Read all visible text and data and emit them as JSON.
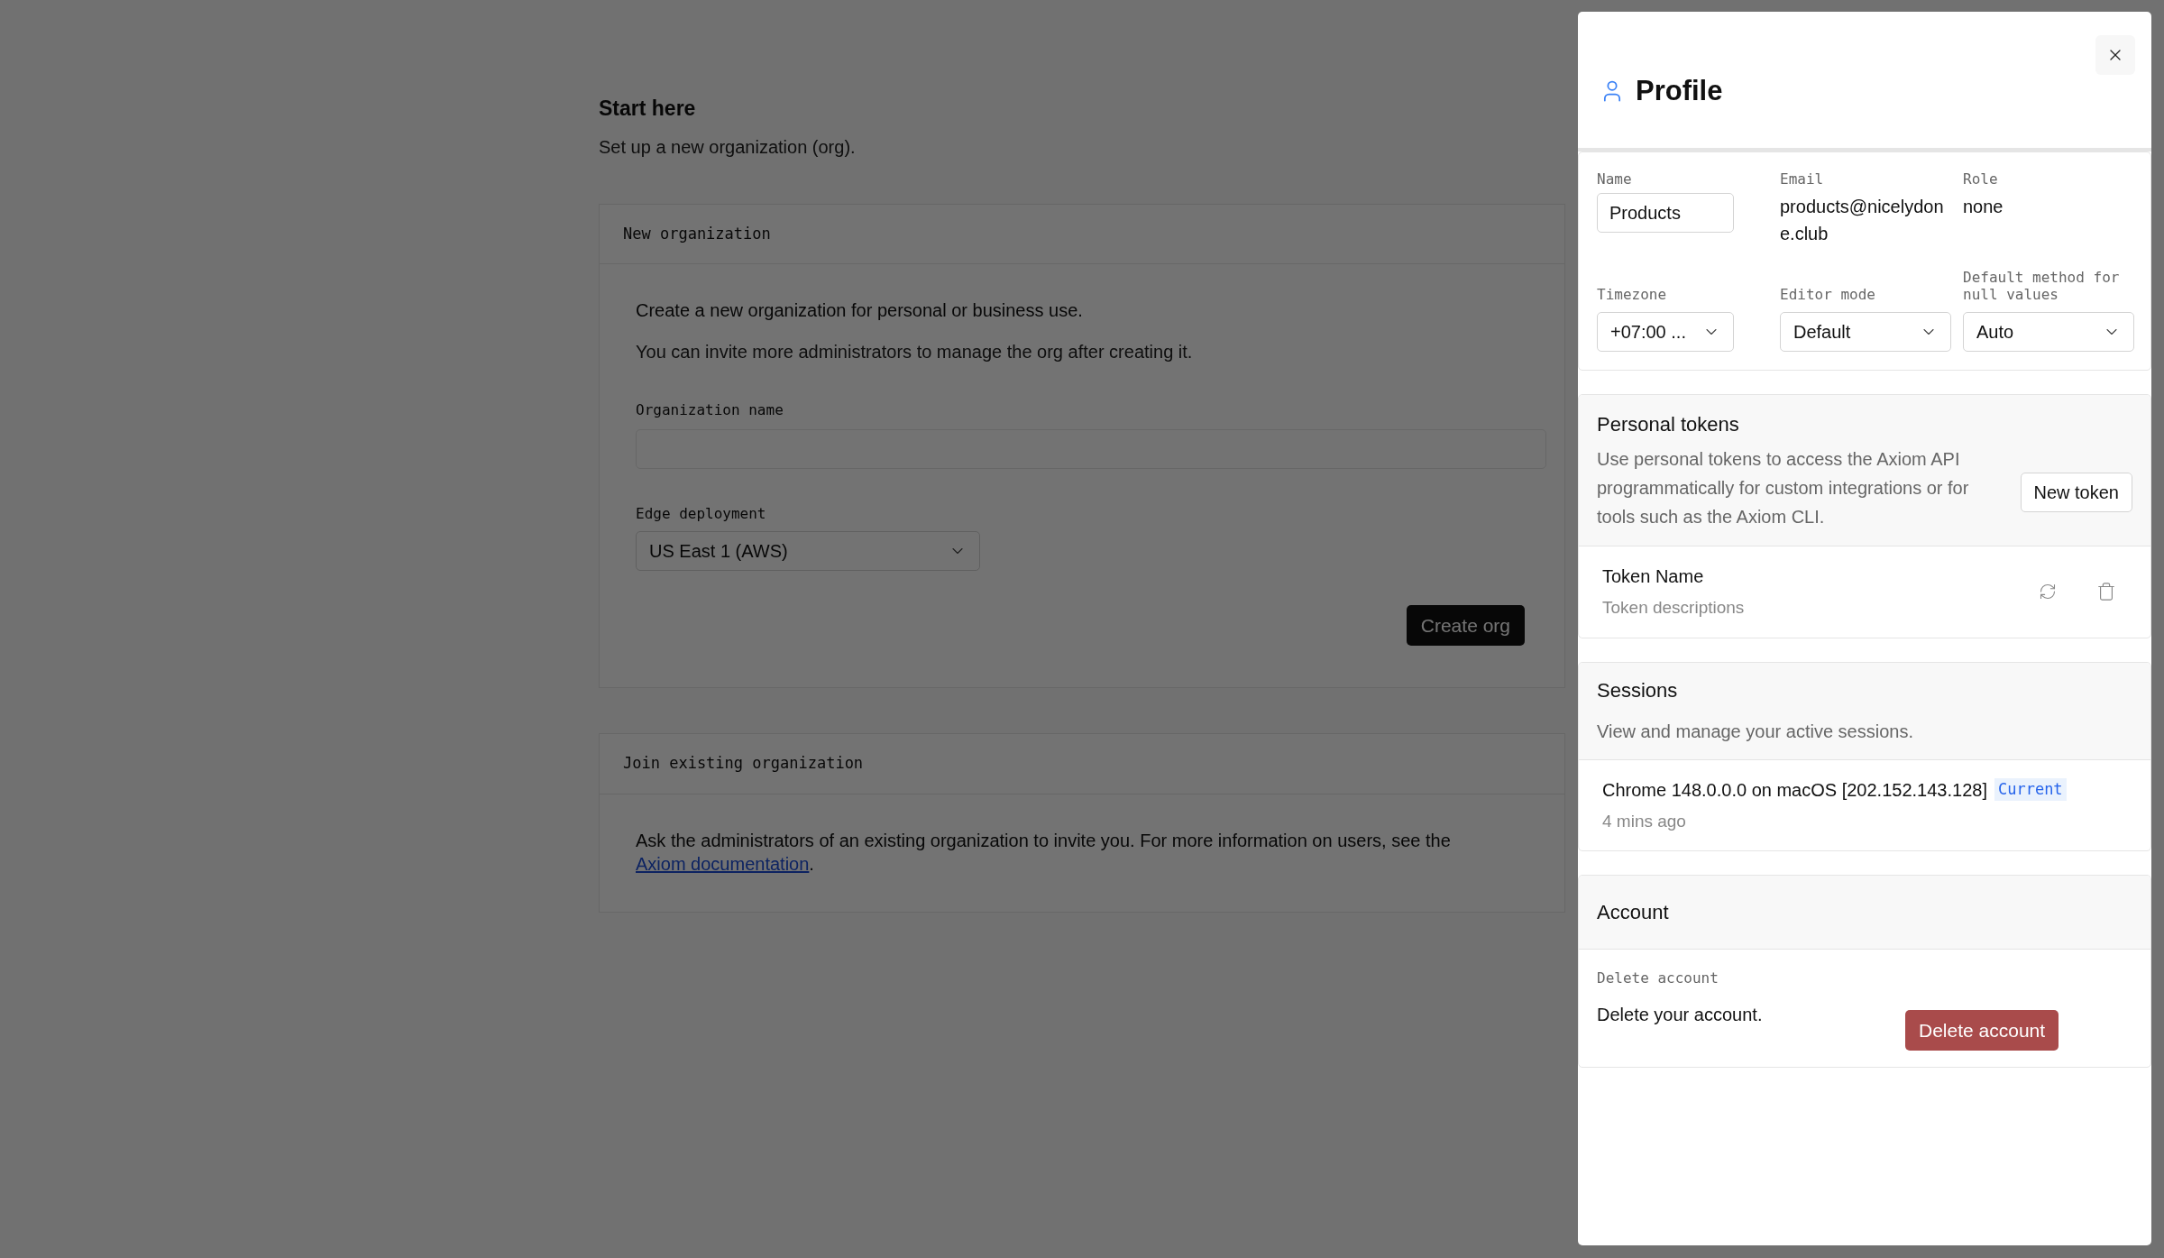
{
  "page": {
    "title": "Start here",
    "subtitle": "Set up a new organization (org).",
    "new_org": {
      "heading": "New organization",
      "lead": "Create a new organization for personal or business use.",
      "note": "You can invite more administrators to manage the org after creating it.",
      "name_label": "Organization name",
      "edge_label": "Edge deployment",
      "edge_value": "US East 1 (AWS)",
      "button": "Create org"
    },
    "join_org": {
      "heading": "Join existing organization",
      "text_before": "Ask the administrators of an existing organization to invite you. For more information on users, see the ",
      "link": "Axiom documentation",
      "text_after": "."
    }
  },
  "profile": {
    "title": "Profile",
    "name": {
      "label": "Name",
      "value": "Products"
    },
    "email": {
      "label": "Email",
      "value": "products@nicelydone.club"
    },
    "role": {
      "label": "Role",
      "value": "none"
    },
    "timezone": {
      "label": "Timezone",
      "value": "+07:00 ..."
    },
    "editor_mode": {
      "label": "Editor mode",
      "value": "Default"
    },
    "null_method": {
      "label": "Default method for null values",
      "value": "Auto"
    },
    "tokens": {
      "title": "Personal tokens",
      "description": "Use personal tokens to access the Axiom API programmatically for custom integrations or for tools such as the Axiom CLI.",
      "button": "New token",
      "items": [
        {
          "name": "Token Name",
          "description": "Token descriptions"
        }
      ]
    },
    "sessions": {
      "title": "Sessions",
      "description": "View and manage your active sessions.",
      "items": [
        {
          "device": "Chrome 148.0.0.0 on macOS [202.152.143.128]",
          "badge": "Current",
          "time": "4 mins ago",
          "current": true
        }
      ]
    },
    "account": {
      "title": "Account",
      "label": "Delete account",
      "description": "Delete your account.",
      "button": "Delete account"
    }
  }
}
